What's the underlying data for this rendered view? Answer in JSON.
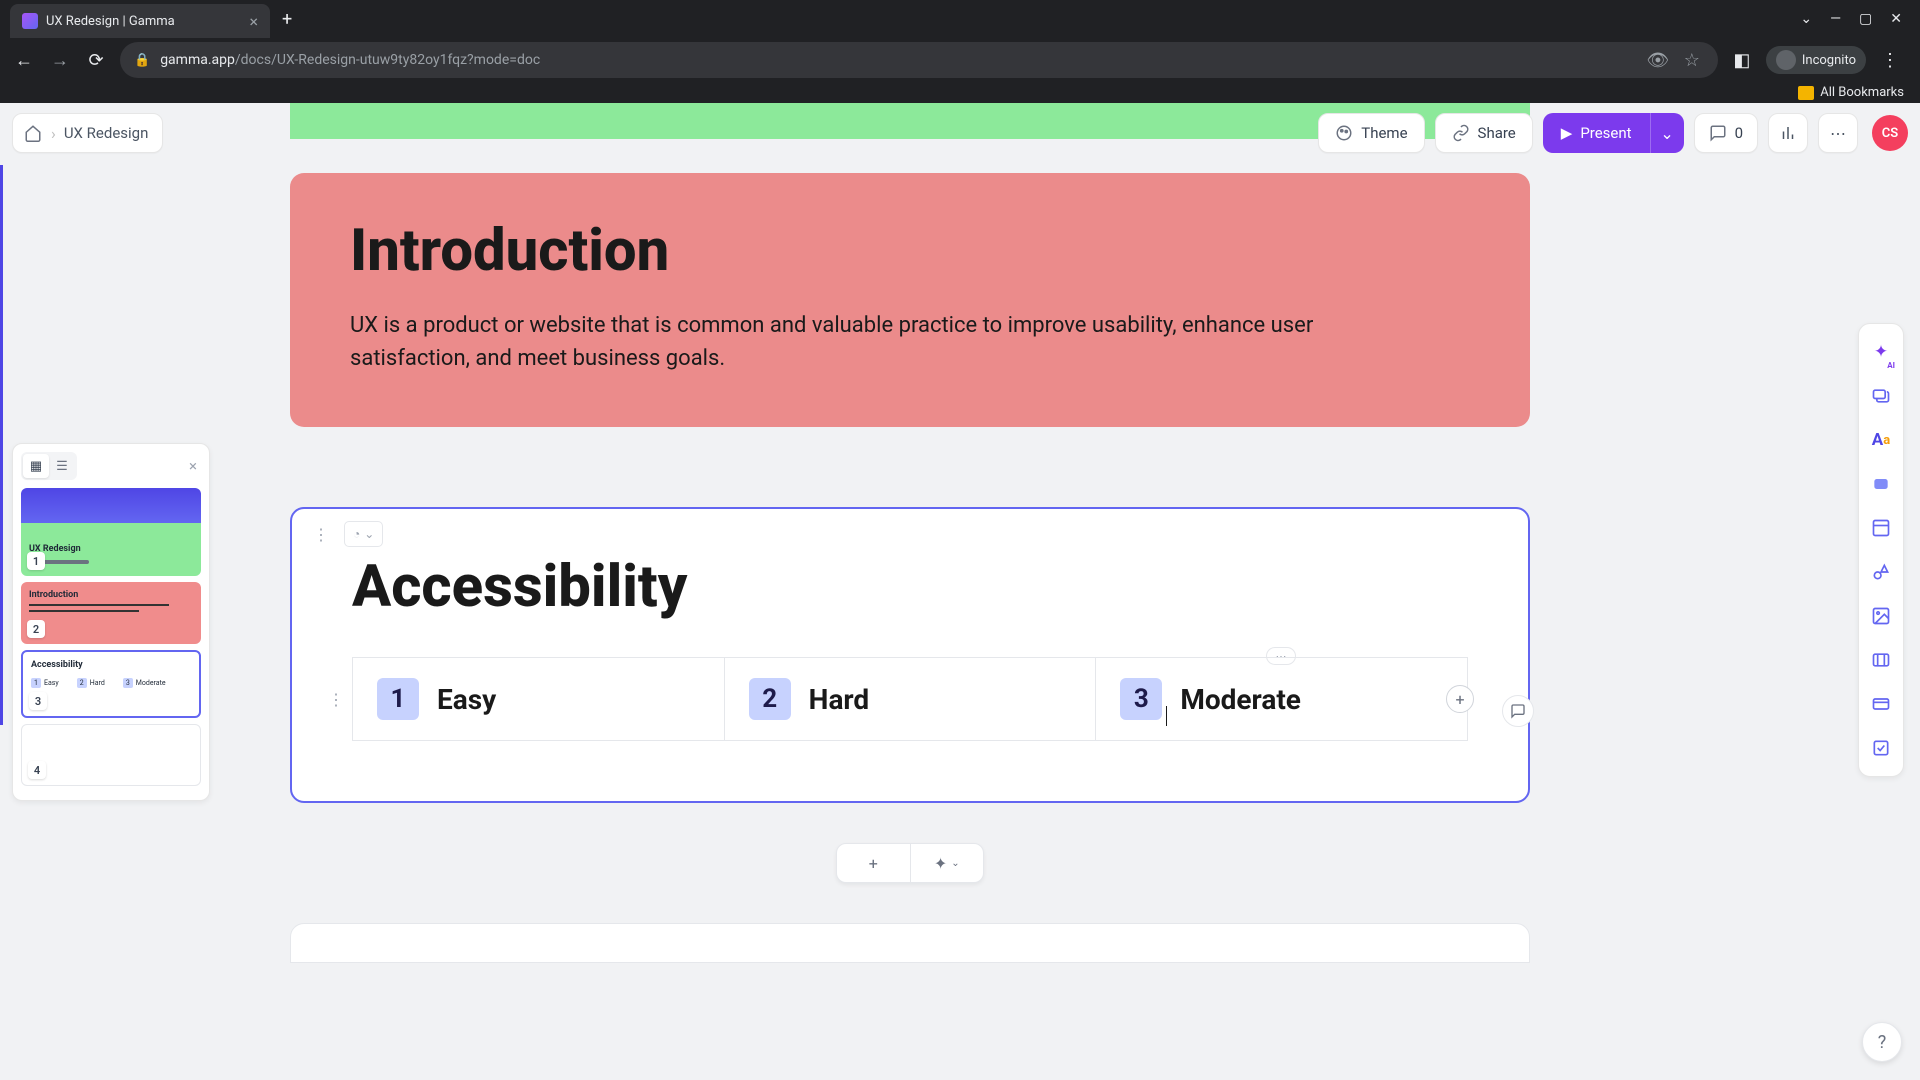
{
  "browser": {
    "tab_title": "UX Redesign | Gamma",
    "url_domain": "gamma.app",
    "url_path": "/docs/UX-Redesign-utuw9ty82oy1fqz?mode=doc",
    "incognito_label": "Incognito",
    "bookmarks_label": "All Bookmarks"
  },
  "breadcrumb": {
    "title": "UX Redesign"
  },
  "toolbar": {
    "theme_label": "Theme",
    "share_label": "Share",
    "present_label": "Present",
    "comment_count": "0",
    "avatar_initials": "CS"
  },
  "cards": {
    "intro": {
      "title": "Introduction",
      "body": "UX is a product or website that is common and valuable practice to improve usability, enhance user satisfaction, and meet business goals."
    },
    "access": {
      "title": "Accessibility",
      "items": [
        {
          "num": "1",
          "label": "Easy"
        },
        {
          "num": "2",
          "label": "Hard"
        },
        {
          "num": "3",
          "label": "Moderate"
        }
      ]
    }
  },
  "sidebar": {
    "thumbs": [
      {
        "badge": "1",
        "title": "UX Redesign"
      },
      {
        "badge": "2",
        "title": "Introduction"
      },
      {
        "badge": "3",
        "title": "Accessibility",
        "items": [
          "Easy",
          "Hard",
          "Moderate"
        ]
      },
      {
        "badge": "4",
        "title": ""
      }
    ]
  },
  "rail": {
    "ai_label": "AI"
  }
}
